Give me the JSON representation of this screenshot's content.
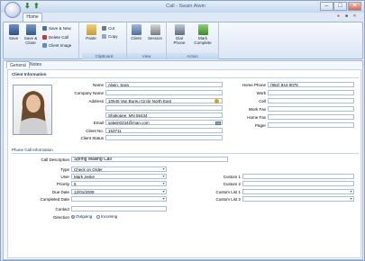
{
  "window": {
    "title": "Call - Swain Alwin"
  },
  "tabs": {
    "home": "Home"
  },
  "ribbon": {
    "actions": {
      "save": "Save",
      "save_close": "Save & Close",
      "save_new": "Save & New",
      "delete_call": "Delete Call",
      "client_image": "Client Image"
    },
    "clipboard": {
      "label": "ClipBoard",
      "paste": "Paste",
      "cut": "Cut",
      "copy": "Copy"
    },
    "view": {
      "label": "View",
      "client": "Client",
      "session": "Session"
    },
    "action": {
      "label": "Action",
      "dial_phone": "Dial Phone",
      "mark_complete": "Mark Complete"
    }
  },
  "form_tabs": {
    "general": "General",
    "notes": "Notes"
  },
  "client_info": {
    "title": "Client Information",
    "name_label": "Name",
    "name": "Alwin, Sara",
    "company_label": "Company Name",
    "company": "",
    "address_label": "Address",
    "address1": "10545 Van Bureu Circle North East",
    "address2": "",
    "address3": "Shakopee, MN 55434",
    "email_label": "Email",
    "email": "salwin0234@man.com",
    "client_no_label": "Client No.",
    "client_no": "153711",
    "client_status_label": "Client Status",
    "client_status": "",
    "home_phone_label": "Home Phone",
    "home_phone": "(952) 944-0075",
    "work_label": "Work",
    "work": "",
    "cell_label": "Cell",
    "cell": "",
    "work_fax_label": "Work Fax",
    "work_fax": "",
    "home_fax_label": "Home Fax",
    "home_fax": "",
    "pager_label": "Pager",
    "pager": ""
  },
  "call_info": {
    "title": "Phone Call Information",
    "description_label": "Call Description",
    "description": "Spring Mailing Call",
    "type_label": "Type",
    "type": "Check on Order",
    "user_label": "User",
    "user": "Mark Jeske",
    "priority_label": "Priority",
    "priority": "5",
    "due_date_label": "Due Date",
    "due_date": "12/01/2009",
    "completed_label": "Completed Date",
    "completed": "",
    "contact_label": "Contact",
    "contact": "",
    "direction_label": "Direction",
    "outgoing": "Outgoing",
    "incoming": "Incoming",
    "custom1_label": "Custom 1",
    "custom2_label": "Custom 2",
    "custom_list1_label": "Custom List 1",
    "custom_list2_label": "Custom List 2"
  },
  "colors": {
    "accent": "#3b5a86",
    "ribbon_bg": "#dbe6f4"
  }
}
